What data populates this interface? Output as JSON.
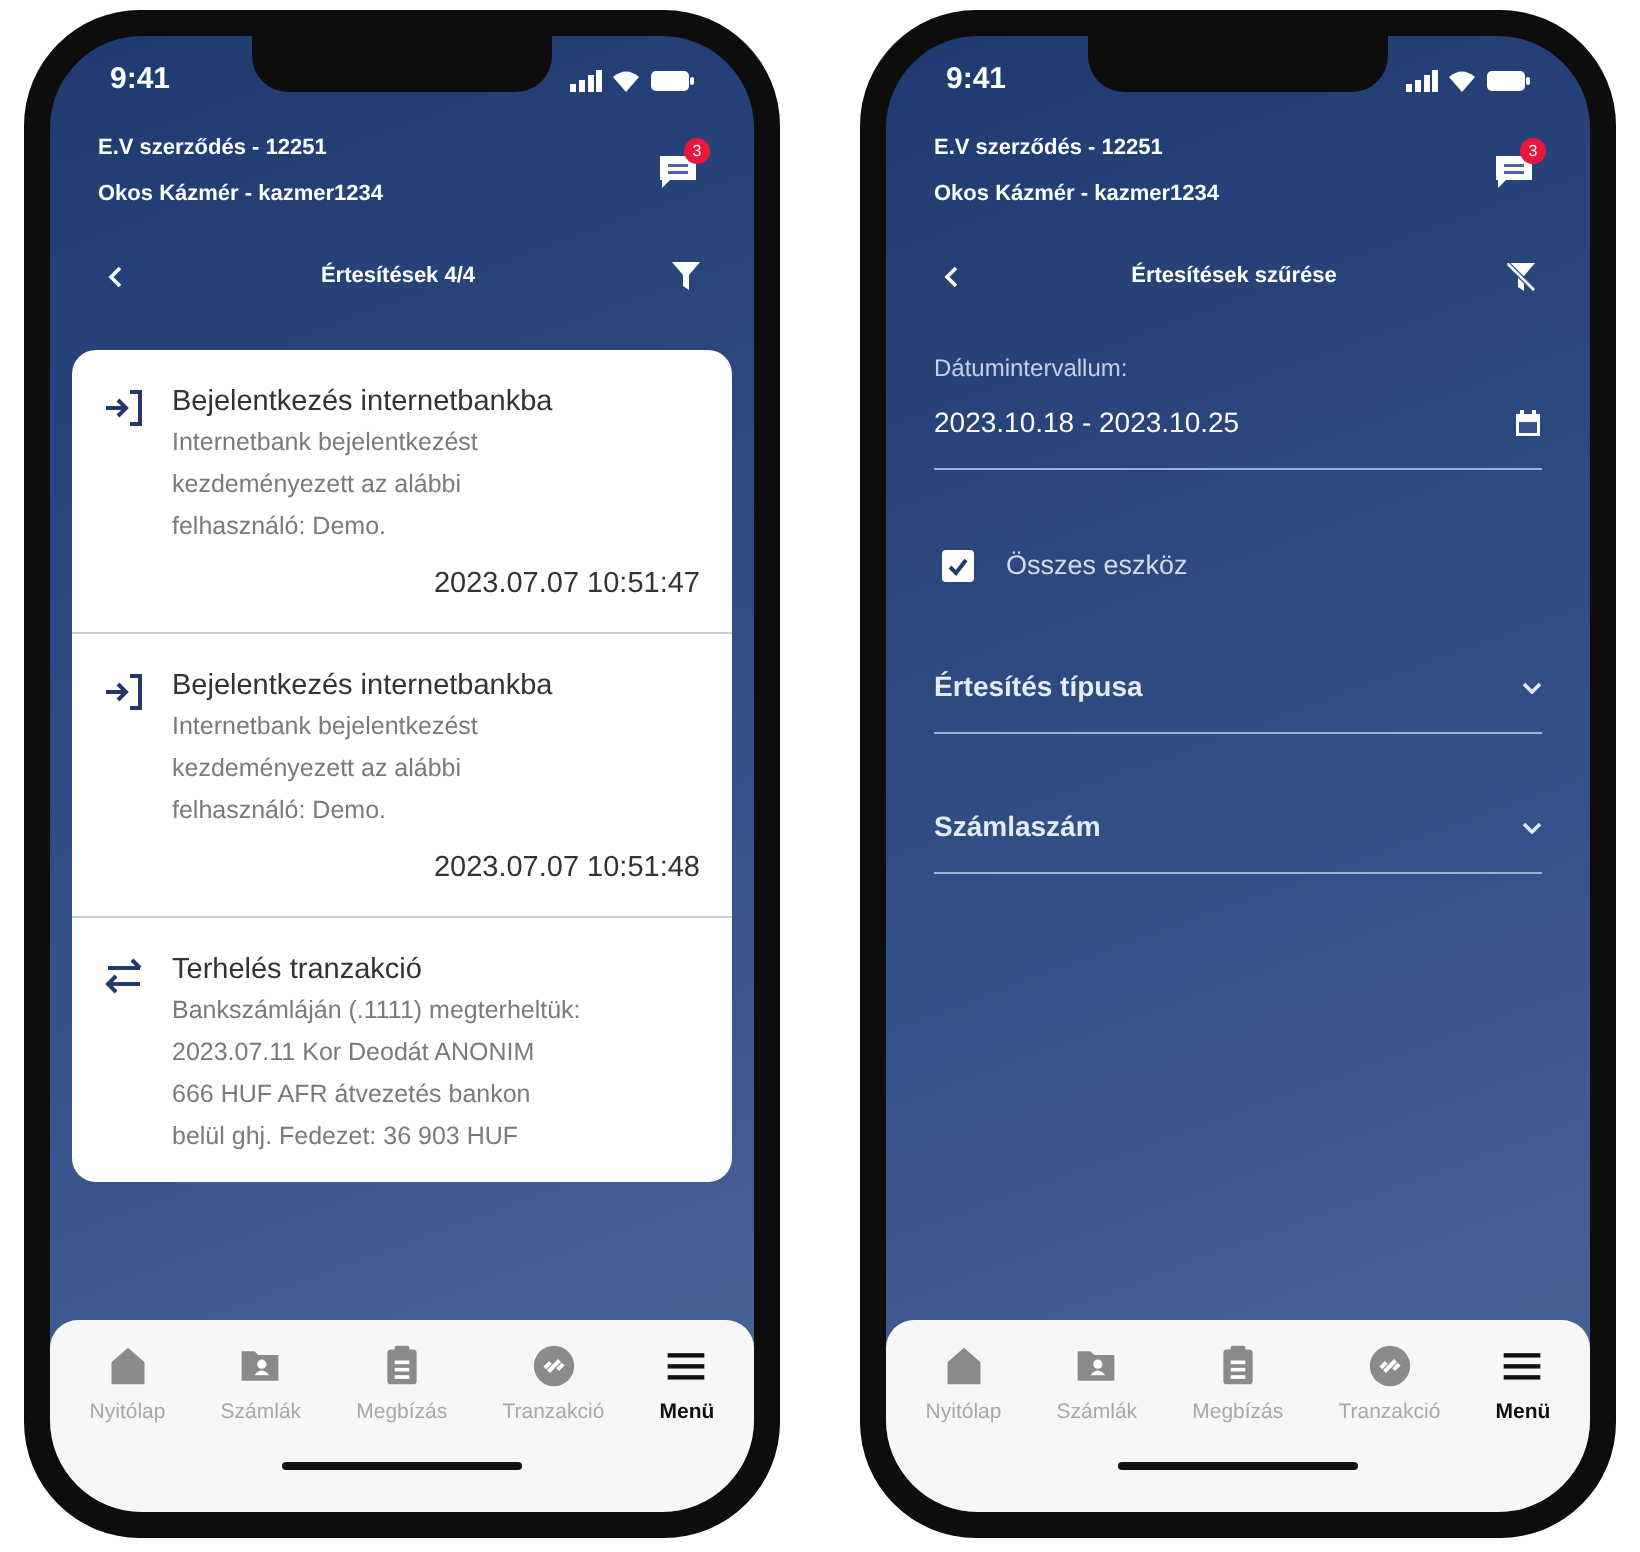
{
  "phones": [
    {
      "kind": "list",
      "status_bar": {
        "time": "9:41"
      },
      "header": {
        "contract": "E.V szerződés - 12251",
        "user": "Okos Kázmér - kazmer1234",
        "badge": "3"
      },
      "toolbar": {
        "title": "Értesítések 4/4",
        "kind": "filter"
      },
      "notifications": [
        {
          "kind": "login",
          "title": "Bejelentkezés internetbankba",
          "body": "Internetbank bejelentkezést kezdeményezett az alábbi felhasználó: Demo.",
          "time": "2023.07.07 10:51:47"
        },
        {
          "kind": "login",
          "title": "Bejelentkezés internetbankba",
          "body": "Internetbank bejelentkezést kezdeményezett az alábbi felhasználó: Demo.",
          "time": "2023.07.07 10:51:48"
        },
        {
          "kind": "transaction",
          "title": "Terhelés tranzakció",
          "body": "Bankszámláján (.1111) megterheltük: 2023.07.11 Kor Deodát ANONIM 666 HUF AFR átvezetés bankon belül ghj. Fedezet: 36 903 HUF"
        }
      ],
      "bottom_nav": [
        {
          "kind": "home",
          "label": "Nyitólap",
          "selected": false
        },
        {
          "kind": "accounts",
          "label": "Számlák",
          "selected": false
        },
        {
          "kind": "orders",
          "label": "Megbízás",
          "selected": false
        },
        {
          "kind": "transactions",
          "label": "Tranzakció",
          "selected": false
        },
        {
          "kind": "menu",
          "label": "Menü",
          "selected": true
        }
      ]
    },
    {
      "kind": "filter",
      "status_bar": {
        "time": "9:41"
      },
      "header": {
        "contract": "E.V szerződés - 12251",
        "user": "Okos Kázmér - kazmer1234",
        "badge": "3"
      },
      "toolbar": {
        "title": "Értesítések szűrése",
        "kind": "clear"
      },
      "filter": {
        "date_label": "Dátumintervallum:",
        "date_value": "2023.10.18 - 2023.10.25",
        "all_devices": {
          "label": "Összes eszköz",
          "checked": true
        },
        "dropdowns": [
          "Értesítés típusa",
          "Számlaszám"
        ]
      },
      "bottom_nav": [
        {
          "kind": "home",
          "label": "Nyitólap",
          "selected": false
        },
        {
          "kind": "accounts",
          "label": "Számlák",
          "selected": false
        },
        {
          "kind": "orders",
          "label": "Megbízás",
          "selected": false
        },
        {
          "kind": "transactions",
          "label": "Tranzakció",
          "selected": false
        },
        {
          "kind": "menu",
          "label": "Menü",
          "selected": true
        }
      ]
    }
  ]
}
